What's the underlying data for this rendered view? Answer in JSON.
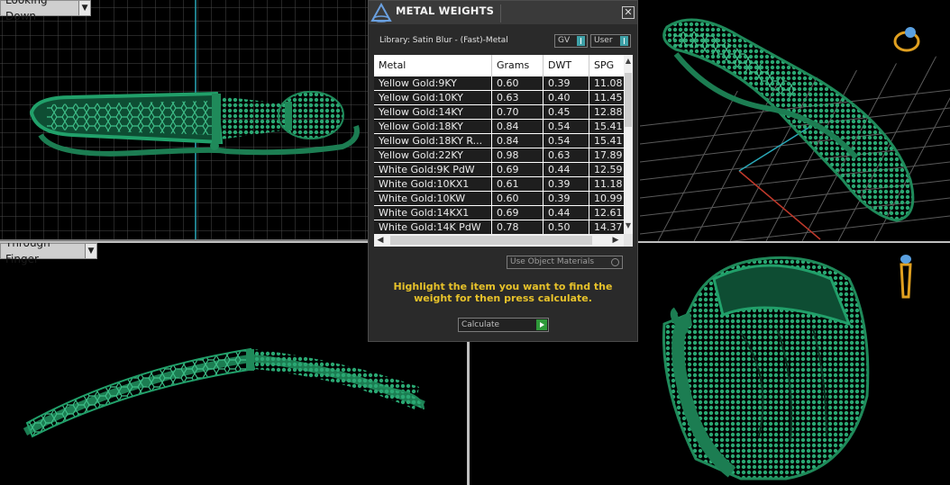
{
  "viewports": {
    "top_left_label": "Looking Down",
    "bottom_left_label": "Through Finger"
  },
  "dialog": {
    "title": "METAL WEIGHTS",
    "close_icon": "close-icon",
    "library": "Library: Satin Blur - (Fast)-Metal",
    "gv_label": "GV",
    "user_label": "User",
    "columns": [
      "Metal",
      "Grams",
      "DWT",
      "SPG"
    ],
    "rows": [
      [
        "Yellow Gold:9KY",
        "0.60",
        "0.39",
        "11.08"
      ],
      [
        "Yellow Gold:10KY",
        "0.63",
        "0.40",
        "11.45"
      ],
      [
        "Yellow Gold:14KY",
        "0.70",
        "0.45",
        "12.88"
      ],
      [
        "Yellow Gold:18KY",
        "0.84",
        "0.54",
        "15.41"
      ],
      [
        "Yellow Gold:18KY R...",
        "0.84",
        "0.54",
        "15.41"
      ],
      [
        "Yellow Gold:22KY",
        "0.98",
        "0.63",
        "17.89"
      ],
      [
        "White Gold:9K PdW",
        "0.69",
        "0.44",
        "12.59"
      ],
      [
        "White Gold:10KX1",
        "0.61",
        "0.39",
        "11.18"
      ],
      [
        "White Gold:10KW",
        "0.60",
        "0.39",
        "10.99"
      ],
      [
        "White Gold:14KX1",
        "0.69",
        "0.44",
        "12.61"
      ],
      [
        "White Gold:14K PdW",
        "0.78",
        "0.50",
        "14.37"
      ]
    ],
    "use_object_materials": "Use Object Materials",
    "instruction": "Highlight the item you want to find the weight for then press calculate.",
    "calculate_label": "Calculate"
  },
  "colors": {
    "ring_green": "#1f8a5a",
    "accent_yellow": "#e7c22a",
    "grid": "#3a3a3a"
  }
}
